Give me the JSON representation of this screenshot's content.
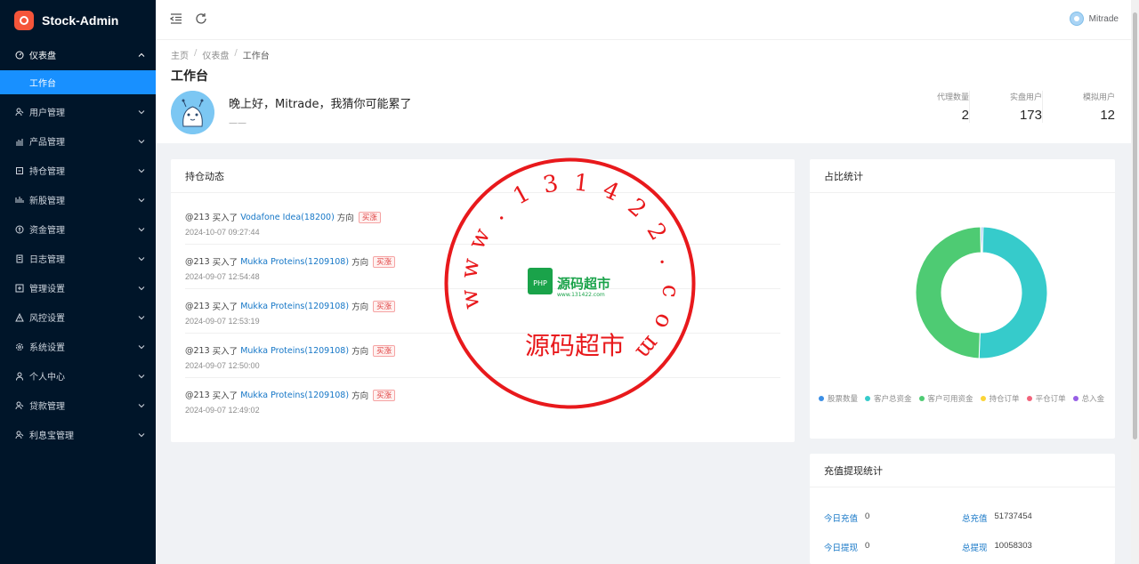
{
  "app": {
    "title": "Stock-Admin"
  },
  "sidebar": {
    "items": [
      {
        "label": "仪表盘",
        "icon": "dashboard-icon",
        "open": true
      },
      {
        "label": "用户管理",
        "icon": "users-icon"
      },
      {
        "label": "产品管理",
        "icon": "chart-icon"
      },
      {
        "label": "持仓管理",
        "icon": "position-icon"
      },
      {
        "label": "新股管理",
        "icon": "ipo-icon"
      },
      {
        "label": "资金管理",
        "icon": "money-icon"
      },
      {
        "label": "日志管理",
        "icon": "log-icon"
      },
      {
        "label": "管理设置",
        "icon": "admin-icon"
      },
      {
        "label": "风控设置",
        "icon": "warning-icon"
      },
      {
        "label": "系统设置",
        "icon": "settings-icon"
      },
      {
        "label": "个人中心",
        "icon": "user-icon"
      },
      {
        "label": "贷款管理",
        "icon": "loan-icon"
      },
      {
        "label": "利息宝管理",
        "icon": "interest-icon"
      }
    ],
    "active_sub": "工作台"
  },
  "header": {
    "username": "Mitrade"
  },
  "breadcrumb": [
    "主页",
    "仪表盘",
    "工作台"
  ],
  "page": {
    "title": "工作台",
    "greeting": "晚上好，Mitrade，我猜你可能累了",
    "greeting_sub": "——"
  },
  "stats": [
    {
      "label": "代理数量",
      "value": "2"
    },
    {
      "label": "实盘用户",
      "value": "173"
    },
    {
      "label": "模拟用户",
      "value": "12"
    }
  ],
  "positions": {
    "title": "持仓动态",
    "items": [
      {
        "user": "@213",
        "action": "买入了",
        "stock": "Vodafone Idea(18200)",
        "dir_label": "方向",
        "tag": "买涨",
        "time": "2024-10-07 09:27:44"
      },
      {
        "user": "@213",
        "action": "买入了",
        "stock": "Mukka Proteins(1209108)",
        "dir_label": "方向",
        "tag": "买涨",
        "time": "2024-09-07 12:54:48"
      },
      {
        "user": "@213",
        "action": "买入了",
        "stock": "Mukka Proteins(1209108)",
        "dir_label": "方向",
        "tag": "买涨",
        "time": "2024-09-07 12:53:19"
      },
      {
        "user": "@213",
        "action": "买入了",
        "stock": "Mukka Proteins(1209108)",
        "dir_label": "方向",
        "tag": "买涨",
        "time": "2024-09-07 12:50:00"
      },
      {
        "user": "@213",
        "action": "买入了",
        "stock": "Mukka Proteins(1209108)",
        "dir_label": "方向",
        "tag": "买涨",
        "time": "2024-09-07 12:49:02"
      }
    ]
  },
  "ratio": {
    "title": "占比统计",
    "legend": [
      {
        "label": "股票数量",
        "color": "#3b8fe6"
      },
      {
        "label": "客户总资金",
        "color": "#36cbcb"
      },
      {
        "label": "客户可用资金",
        "color": "#4ecb73"
      },
      {
        "label": "持仓订单",
        "color": "#fbd437"
      },
      {
        "label": "平仓订单",
        "color": "#f2637b"
      },
      {
        "label": "总入金",
        "color": "#975fe5"
      }
    ]
  },
  "chart_data": {
    "type": "pie",
    "categories": [
      "股票数量",
      "客户总资金",
      "客户可用资金",
      "持仓订单",
      "平仓订单",
      "总入金"
    ],
    "values": [
      0.4,
      50.2,
      49.2,
      0.05,
      0.05,
      0.1
    ]
  },
  "recharge": {
    "title": "充值提现统计",
    "rows": [
      {
        "k1": "今日充值",
        "v1": "0",
        "k2": "总充值",
        "v2": "51737454"
      },
      {
        "k1": "今日提现",
        "v1": "0",
        "k2": "总提现",
        "v2": "10058303"
      }
    ]
  },
  "watermark": {
    "ring_text": "www.131422.com",
    "center_text": "源码超市",
    "center_sub": "www.131422.com",
    "badge_text": "PHP",
    "bottom_text": "源码超市"
  }
}
